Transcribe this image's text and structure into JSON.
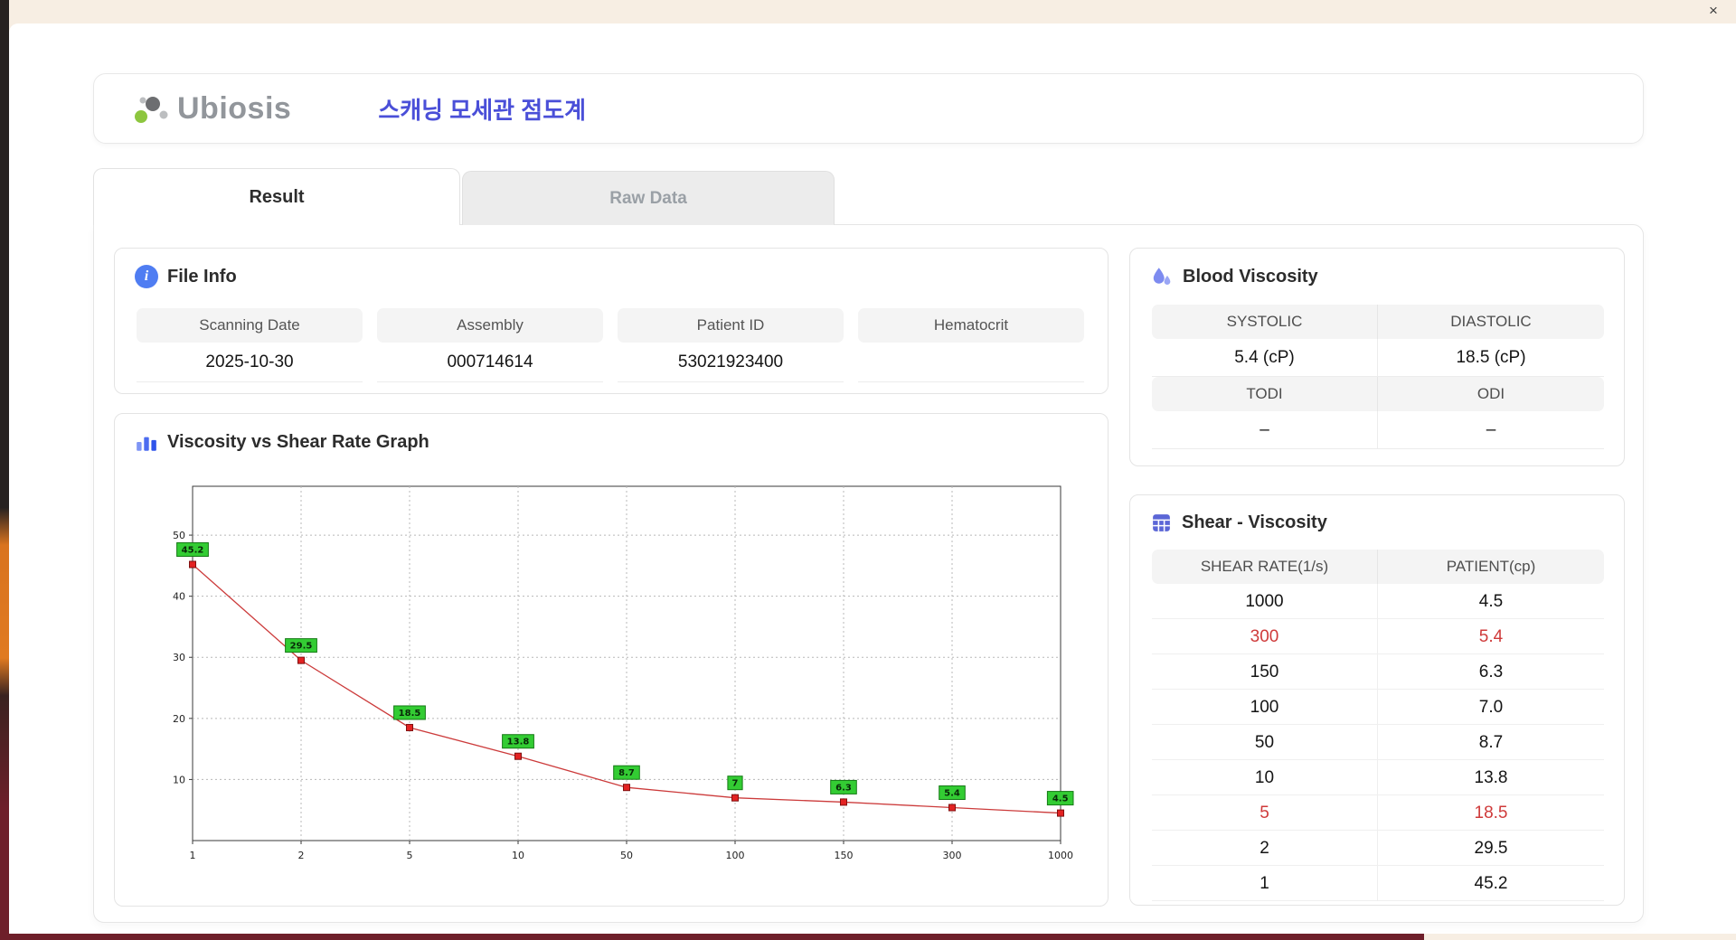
{
  "window": {
    "close_label": "×"
  },
  "header": {
    "logo_text": "Ubiosis",
    "title": "스캐닝 모세관 점도계"
  },
  "tabs": [
    {
      "label": "Result",
      "active": true
    },
    {
      "label": "Raw Data",
      "active": false
    }
  ],
  "file_info": {
    "title": "File Info",
    "fields": [
      {
        "label": "Scanning Date",
        "value": "2025-10-30"
      },
      {
        "label": "Assembly",
        "value": "000714614"
      },
      {
        "label": "Patient ID",
        "value": "53021923400"
      },
      {
        "label": "Hematocrit",
        "value": ""
      }
    ]
  },
  "blood_viscosity": {
    "title": "Blood Viscosity",
    "systolic_label": "SYSTOLIC",
    "diastolic_label": "DIASTOLIC",
    "systolic_value": "5.4 (cP)",
    "diastolic_value": "18.5 (cP)",
    "todi_label": "TODI",
    "odi_label": "ODI",
    "todi_value": "–",
    "odi_value": "–"
  },
  "graph": {
    "title": "Viscosity vs Shear Rate Graph"
  },
  "shear_viscosity": {
    "title": "Shear - Viscosity",
    "columns": [
      "SHEAR RATE(1/s)",
      "PATIENT(cp)"
    ],
    "rows": [
      {
        "rate": "1000",
        "patient": "4.5",
        "highlight": false
      },
      {
        "rate": "300",
        "patient": "5.4",
        "highlight": true
      },
      {
        "rate": "150",
        "patient": "6.3",
        "highlight": false
      },
      {
        "rate": "100",
        "patient": "7.0",
        "highlight": false
      },
      {
        "rate": "50",
        "patient": "8.7",
        "highlight": false
      },
      {
        "rate": "10",
        "patient": "13.8",
        "highlight": false
      },
      {
        "rate": "5",
        "patient": "18.5",
        "highlight": true
      },
      {
        "rate": "2",
        "patient": "29.5",
        "highlight": false
      },
      {
        "rate": "1",
        "patient": "45.2",
        "highlight": false
      }
    ]
  },
  "chart_data": {
    "type": "line",
    "title": "Viscosity vs Shear Rate Graph",
    "x_scale": "categorical-log-ticks",
    "categories": [
      "1",
      "2",
      "5",
      "10",
      "50",
      "100",
      "150",
      "300",
      "1000"
    ],
    "values": [
      45.2,
      29.5,
      18.5,
      13.8,
      8.7,
      7,
      6.3,
      5.4,
      4.5
    ],
    "point_labels": [
      "45.2",
      "29.5",
      "18.5",
      "13.8",
      "8.7",
      "7",
      "6.3",
      "5.4",
      "4.5"
    ],
    "xlabel": "",
    "ylabel": "",
    "yticks": [
      10,
      20,
      30,
      40,
      50
    ],
    "ylim": [
      0,
      58
    ],
    "grid": true,
    "legend": false,
    "line_color": "#cc3b3b",
    "marker_color": "#e32222",
    "marker_edge": "#801010",
    "label_bg": "#33cc33",
    "label_edge": "#157a15"
  }
}
